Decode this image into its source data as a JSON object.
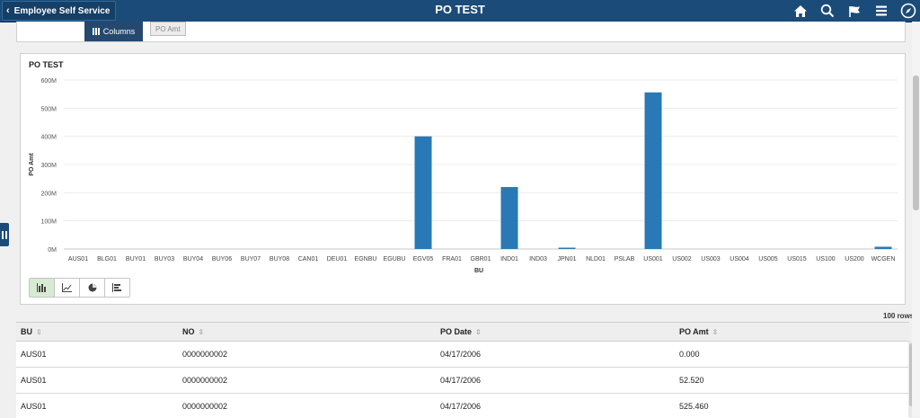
{
  "header": {
    "back_label": "Employee Self Service",
    "title": "PO TEST",
    "icons": [
      "home-icon",
      "search-icon",
      "flag-icon",
      "menu-icon",
      "navbar-icon"
    ]
  },
  "toolbar": {
    "columns_label": "Columns",
    "chip_label": "PO Amt"
  },
  "chart": {
    "chart_types": [
      "bar-chart-icon",
      "line-chart-icon",
      "pie-chart-icon",
      "horizontal-bar-icon"
    ],
    "active_type": "bar-chart-icon"
  },
  "chart_data": {
    "type": "bar",
    "title": "PO TEST",
    "xlabel": "BU",
    "ylabel": "PO Amt",
    "ylim": [
      0,
      600000000
    ],
    "yticks": [
      "0M",
      "100M",
      "200M",
      "300M",
      "400M",
      "500M",
      "600M"
    ],
    "categories": [
      "AUS01",
      "BLG01",
      "BUY01",
      "BUY03",
      "BUY04",
      "BUY06",
      "BUY07",
      "BUY08",
      "CAN01",
      "DEU01",
      "EGNBU",
      "EGUBU",
      "EGV05",
      "FRA01",
      "GBR01",
      "IND01",
      "IND03",
      "JPN01",
      "NLD01",
      "PSLAB",
      "US001",
      "US002",
      "US003",
      "US004",
      "US005",
      "US015",
      "US100",
      "US200",
      "WCGEN"
    ],
    "values": [
      0,
      0,
      0,
      0,
      0,
      0,
      0,
      0,
      0,
      0,
      0,
      0,
      400000000,
      0,
      0,
      220000000,
      0,
      2000000,
      0,
      0,
      556000000,
      0,
      0,
      0,
      0,
      0,
      0,
      0,
      8000000
    ],
    "color": "#2879b5",
    "grid": true
  },
  "grid": {
    "rows_count": "100 rows",
    "headers": [
      "BU",
      "NO",
      "PO Date",
      "PO Amt"
    ],
    "rows": [
      [
        "AUS01",
        "0000000002",
        "04/17/2006",
        "0.000"
      ],
      [
        "AUS01",
        "0000000002",
        "04/17/2006",
        "52.520"
      ],
      [
        "AUS01",
        "0000000002",
        "04/17/2006",
        "525.460"
      ]
    ]
  }
}
